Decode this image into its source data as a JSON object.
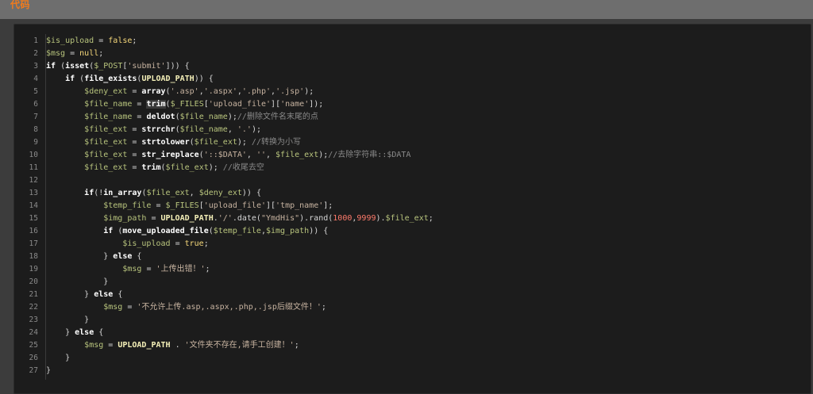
{
  "header": {
    "title": "代码"
  },
  "colors": {
    "title_accent": "#f07b1d",
    "panel_bg": "#1c1c1c",
    "page_bg": "#6a6a6a"
  },
  "code_lines": [
    {
      "n": "1",
      "tokens": [
        [
          "var",
          "$is_upload"
        ],
        [
          "op",
          " = "
        ],
        [
          "val",
          "false"
        ],
        [
          "op",
          ";"
        ]
      ]
    },
    {
      "n": "2",
      "tokens": [
        [
          "var",
          "$msg"
        ],
        [
          "op",
          " = "
        ],
        [
          "val",
          "null"
        ],
        [
          "op",
          ";"
        ]
      ]
    },
    {
      "n": "3",
      "tokens": [
        [
          "kw",
          "if"
        ],
        [
          "op",
          " ("
        ],
        [
          "fn",
          "isset"
        ],
        [
          "op",
          "("
        ],
        [
          "var",
          "$_POST"
        ],
        [
          "op",
          "["
        ],
        [
          "str",
          "'submit'"
        ],
        [
          "op",
          "])) {"
        ]
      ]
    },
    {
      "n": "4",
      "tokens": [
        [
          "op",
          "    "
        ],
        [
          "kw",
          "if"
        ],
        [
          "op",
          " ("
        ],
        [
          "fn",
          "file_exists"
        ],
        [
          "op",
          "("
        ],
        [
          "const",
          "UPLOAD_PATH"
        ],
        [
          "op",
          ")) {"
        ]
      ]
    },
    {
      "n": "5",
      "tokens": [
        [
          "op",
          "        "
        ],
        [
          "var",
          "$deny_ext"
        ],
        [
          "op",
          " = "
        ],
        [
          "fn",
          "array"
        ],
        [
          "op",
          "("
        ],
        [
          "str",
          "'.asp'"
        ],
        [
          "op",
          ","
        ],
        [
          "str",
          "'.aspx'"
        ],
        [
          "op",
          ","
        ],
        [
          "str",
          "'.php'"
        ],
        [
          "op",
          ","
        ],
        [
          "str",
          "'.jsp'"
        ],
        [
          "op",
          ");"
        ]
      ]
    },
    {
      "n": "6",
      "tokens": [
        [
          "op",
          "        "
        ],
        [
          "var",
          "$file_name"
        ],
        [
          "op",
          " = "
        ],
        [
          "hl",
          "trim"
        ],
        [
          "op",
          "("
        ],
        [
          "var",
          "$_FILES"
        ],
        [
          "op",
          "["
        ],
        [
          "str",
          "'upload_file'"
        ],
        [
          "op",
          "]["
        ],
        [
          "str",
          "'name'"
        ],
        [
          "op",
          "]);"
        ]
      ]
    },
    {
      "n": "7",
      "tokens": [
        [
          "op",
          "        "
        ],
        [
          "var",
          "$file_name"
        ],
        [
          "op",
          " = "
        ],
        [
          "fn",
          "deldot"
        ],
        [
          "op",
          "("
        ],
        [
          "var",
          "$file_name"
        ],
        [
          "op",
          ");"
        ],
        [
          "com",
          "//删除文件名末尾的点"
        ]
      ]
    },
    {
      "n": "8",
      "tokens": [
        [
          "op",
          "        "
        ],
        [
          "var",
          "$file_ext"
        ],
        [
          "op",
          " = "
        ],
        [
          "fn",
          "strrchr"
        ],
        [
          "op",
          "("
        ],
        [
          "var",
          "$file_name"
        ],
        [
          "op",
          ", "
        ],
        [
          "str",
          "'.'"
        ],
        [
          "op",
          ");"
        ]
      ]
    },
    {
      "n": "9",
      "tokens": [
        [
          "op",
          "        "
        ],
        [
          "var",
          "$file_ext"
        ],
        [
          "op",
          " = "
        ],
        [
          "fn",
          "strtolower"
        ],
        [
          "op",
          "("
        ],
        [
          "var",
          "$file_ext"
        ],
        [
          "op",
          "); "
        ],
        [
          "com",
          "//转换为小写"
        ]
      ]
    },
    {
      "n": "10",
      "tokens": [
        [
          "op",
          "        "
        ],
        [
          "var",
          "$file_ext"
        ],
        [
          "op",
          " = "
        ],
        [
          "fn",
          "str_ireplace"
        ],
        [
          "op",
          "("
        ],
        [
          "str",
          "'::$DATA'"
        ],
        [
          "op",
          ", "
        ],
        [
          "str",
          "''"
        ],
        [
          "op",
          ", "
        ],
        [
          "var",
          "$file_ext"
        ],
        [
          "op",
          ");"
        ],
        [
          "com",
          "//去除字符串::$DATA"
        ]
      ]
    },
    {
      "n": "11",
      "tokens": [
        [
          "op",
          "        "
        ],
        [
          "var",
          "$file_ext"
        ],
        [
          "op",
          " = "
        ],
        [
          "fn",
          "trim"
        ],
        [
          "op",
          "("
        ],
        [
          "var",
          "$file_ext"
        ],
        [
          "op",
          "); "
        ],
        [
          "com",
          "//收尾去空"
        ]
      ]
    },
    {
      "n": "12",
      "tokens": []
    },
    {
      "n": "13",
      "tokens": [
        [
          "op",
          "        "
        ],
        [
          "kw",
          "if"
        ],
        [
          "op",
          "(!"
        ],
        [
          "fn",
          "in_array"
        ],
        [
          "op",
          "("
        ],
        [
          "var",
          "$file_ext"
        ],
        [
          "op",
          ", "
        ],
        [
          "var",
          "$deny_ext"
        ],
        [
          "op",
          ")) {"
        ]
      ]
    },
    {
      "n": "14",
      "tokens": [
        [
          "op",
          "            "
        ],
        [
          "var",
          "$temp_file"
        ],
        [
          "op",
          " = "
        ],
        [
          "var",
          "$_FILES"
        ],
        [
          "op",
          "["
        ],
        [
          "str",
          "'upload_file'"
        ],
        [
          "op",
          "]["
        ],
        [
          "str",
          "'tmp_name'"
        ],
        [
          "op",
          "];"
        ]
      ]
    },
    {
      "n": "15",
      "tokens": [
        [
          "op",
          "            "
        ],
        [
          "var",
          "$img_path"
        ],
        [
          "op",
          " = "
        ],
        [
          "const",
          "UPLOAD_PATH"
        ],
        [
          "op",
          "."
        ],
        [
          "str",
          "'/'"
        ],
        [
          "op",
          ".date("
        ],
        [
          "str",
          "\"YmdHis\""
        ],
        [
          "op",
          ").rand("
        ],
        [
          "num",
          "1000"
        ],
        [
          "op",
          ","
        ],
        [
          "num",
          "9999"
        ],
        [
          "op",
          ")."
        ],
        [
          "var",
          "$file_ext"
        ],
        [
          "op",
          ";"
        ]
      ]
    },
    {
      "n": "16",
      "tokens": [
        [
          "op",
          "            "
        ],
        [
          "kw",
          "if"
        ],
        [
          "op",
          " ("
        ],
        [
          "fn",
          "move_uploaded_file"
        ],
        [
          "op",
          "("
        ],
        [
          "var",
          "$temp_file"
        ],
        [
          "op",
          ","
        ],
        [
          "var",
          "$img_path"
        ],
        [
          "op",
          ")) {"
        ]
      ]
    },
    {
      "n": "17",
      "tokens": [
        [
          "op",
          "                "
        ],
        [
          "var",
          "$is_upload"
        ],
        [
          "op",
          " = "
        ],
        [
          "val",
          "true"
        ],
        [
          "op",
          ";"
        ]
      ]
    },
    {
      "n": "18",
      "tokens": [
        [
          "op",
          "            "
        ],
        [
          "op",
          "} "
        ],
        [
          "kw",
          "else"
        ],
        [
          "op",
          " {"
        ]
      ]
    },
    {
      "n": "19",
      "tokens": [
        [
          "op",
          "                "
        ],
        [
          "var",
          "$msg"
        ],
        [
          "op",
          " = "
        ],
        [
          "str",
          "'上传出错！'"
        ],
        [
          "op",
          ";"
        ]
      ]
    },
    {
      "n": "20",
      "tokens": [
        [
          "op",
          "            }"
        ]
      ]
    },
    {
      "n": "21",
      "tokens": [
        [
          "op",
          "        "
        ],
        [
          "op",
          "} "
        ],
        [
          "kw",
          "else"
        ],
        [
          "op",
          " {"
        ]
      ]
    },
    {
      "n": "22",
      "tokens": [
        [
          "op",
          "            "
        ],
        [
          "var",
          "$msg"
        ],
        [
          "op",
          " = "
        ],
        [
          "str",
          "'不允许上传.asp,.aspx,.php,.jsp后缀文件！'"
        ],
        [
          "op",
          ";"
        ]
      ]
    },
    {
      "n": "23",
      "tokens": [
        [
          "op",
          "        }"
        ]
      ]
    },
    {
      "n": "24",
      "tokens": [
        [
          "op",
          "    "
        ],
        [
          "op",
          "} "
        ],
        [
          "kw",
          "else"
        ],
        [
          "op",
          " {"
        ]
      ]
    },
    {
      "n": "25",
      "tokens": [
        [
          "op",
          "        "
        ],
        [
          "var",
          "$msg"
        ],
        [
          "op",
          " = "
        ],
        [
          "const",
          "UPLOAD_PATH"
        ],
        [
          "op",
          " . "
        ],
        [
          "str",
          "'文件夹不存在,请手工创建！'"
        ],
        [
          "op",
          ";"
        ]
      ]
    },
    {
      "n": "26",
      "tokens": [
        [
          "op",
          "    }"
        ]
      ]
    },
    {
      "n": "27",
      "tokens": [
        [
          "op",
          "}"
        ]
      ]
    }
  ]
}
